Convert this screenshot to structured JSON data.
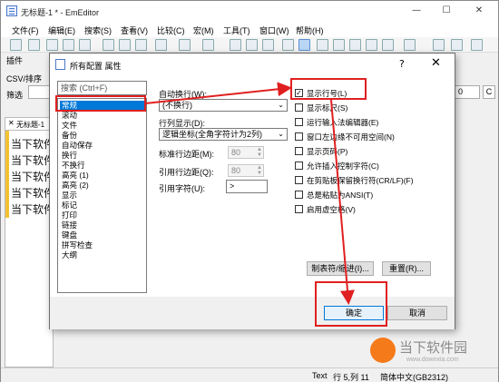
{
  "window": {
    "title": "无标题-1 * - EmEditor",
    "minimize": "—",
    "maximize": "☐",
    "close": "✕"
  },
  "menu": [
    "文件(F)",
    "编辑(E)",
    "搜索(S)",
    "查看(V)",
    "比较(C)",
    "宏(M)",
    "工具(T)",
    "窗口(W)",
    "帮助(H)"
  ],
  "side": {
    "tab_label": "插件",
    "csv_label": "CSV/排序",
    "filter_label": "筛选",
    "doc_tab": "无标题-1",
    "editor_lines": [
      "当下软件",
      "当下软件",
      "当下软件",
      "当下软件",
      "当下软件",
      "当下软件"
    ]
  },
  "right_controls": {
    "combo_value": "0",
    "btn_label": "C"
  },
  "status": {
    "mode": "Text",
    "position": "行 5,列 11",
    "encoding": "简体中文(GB2312)"
  },
  "dialog": {
    "title": "所有配置 属性",
    "help": "?",
    "close": "✕",
    "search_placeholder": "搜索 (Ctrl+F)",
    "categories": [
      "常规",
      "滚动",
      "文件",
      "备份",
      "自动保存",
      "换行",
      "不换行",
      "高亮 (1)",
      "高亮 (2)",
      "显示",
      "标记",
      "打印",
      "链接",
      "键盘",
      "拼写检查",
      "大纲"
    ],
    "selected_category": "常规",
    "wrap_label": "自动换行(W):",
    "wrap_value": "(不换行)",
    "column_label": "行列显示(D):",
    "column_value": "逻辑坐标(全角字符计为2列)",
    "std_margin_label": "标准行边距(M):",
    "std_margin_value": "80",
    "quote_margin_label": "引用行边距(Q):",
    "quote_margin_value": "80",
    "quote_char_label": "引用字符(U):",
    "quote_char_value": ">",
    "checkboxes": [
      {
        "label": "显示行号(L)",
        "checked": true
      },
      {
        "label": "显示标尺(S)",
        "checked": false
      },
      {
        "label": "运行输入法编辑器(E)",
        "checked": false
      },
      {
        "label": "窗口左边缘不可用空间(N)",
        "checked": false
      },
      {
        "label": "显示页码(P)",
        "checked": false
      },
      {
        "label": "允许插入控制字符(C)",
        "checked": false
      },
      {
        "label": "在剪贴板保留换行符(CR/LF)(F)",
        "checked": false
      },
      {
        "label": "总是粘贴为ANSI(T)",
        "checked": false
      },
      {
        "label": "启用虚空格(V)",
        "checked": false
      }
    ],
    "tab_indent_button": "制表符/缩进(I)...",
    "reset_button": "重置(R)...",
    "ok_button": "确定",
    "cancel_button": "取消"
  },
  "watermark": {
    "text": "当下软件园",
    "url": "www.downxia.com"
  },
  "colors": {
    "annotation": "#e02020",
    "selection": "#0078d7",
    "editor_marker": "#f2c232"
  }
}
